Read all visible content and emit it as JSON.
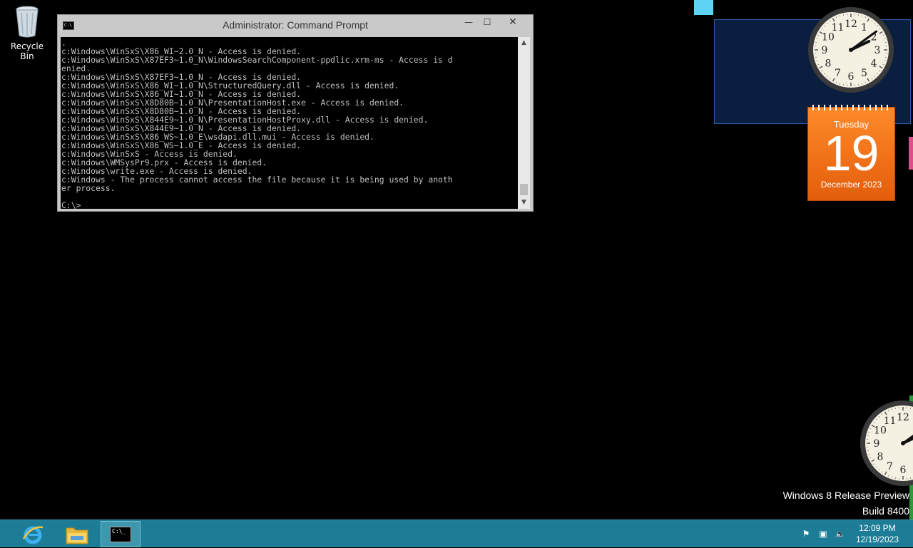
{
  "desktop": {
    "recycle_bin_label": "Recycle Bin",
    "watermark_line1": "Windows 8 Release Preview",
    "watermark_line2": "Build 8400"
  },
  "window": {
    "title": "Administrator: Command Prompt",
    "sys_icon_text": "C:\\",
    "minimize": "—",
    "maximize": "☐",
    "close": "✕",
    "output": ".\nc:Windows\\WinSxS\\X86_WI~2.0_N - Access is denied.\nc:Windows\\WinSxS\\X87EF3~1.0_N\\WindowsSearchComponent-ppdlic.xrm-ms - Access is d\nenied.\nc:Windows\\WinSxS\\X87EF3~1.0_N - Access is denied.\nc:Windows\\WinSxS\\X86_WI~1.0_N\\StructuredQuery.dll - Access is denied.\nc:Windows\\WinSxS\\X86_WI~1.0_N - Access is denied.\nc:Windows\\WinSxS\\X8D80B~1.0_N\\PresentationHost.exe - Access is denied.\nc:Windows\\WinSxS\\X8D80B~1.0_N - Access is denied.\nc:Windows\\WinSxS\\X844E9~1.0_N\\PresentationHostProxy.dll - Access is denied.\nc:Windows\\WinSxS\\X844E9~1.0_N - Access is denied.\nc:Windows\\WinSxS\\X86_WS~1.0_E\\wsdapi.dll.mui - Access is denied.\nc:Windows\\WinSxS\\X86_WS~1.0_E - Access is denied.\nc:Windows\\WinSxS - Access is denied.\nc:Windows\\WMSysPr9.prx - Access is denied.\nc:Windows\\write.exe - Access is denied.\nc:Windows - The process cannot access the file because it is being used by anoth\ner process.\n\nC:\\>"
  },
  "calendar": {
    "day": "Tuesday",
    "date": "19",
    "month_year": "December 2023"
  },
  "clock_gadget": {
    "hour": 2,
    "minute": 9
  },
  "taskbar": {
    "time": "12:09 PM",
    "date": "12/19/2023",
    "cmd_icon_text": "C:\\_"
  },
  "colors": {
    "taskbar": "#1d7d97",
    "calendar": "#f07a1f",
    "console_bg": "#000000",
    "console_text": "#c0c0c0"
  }
}
